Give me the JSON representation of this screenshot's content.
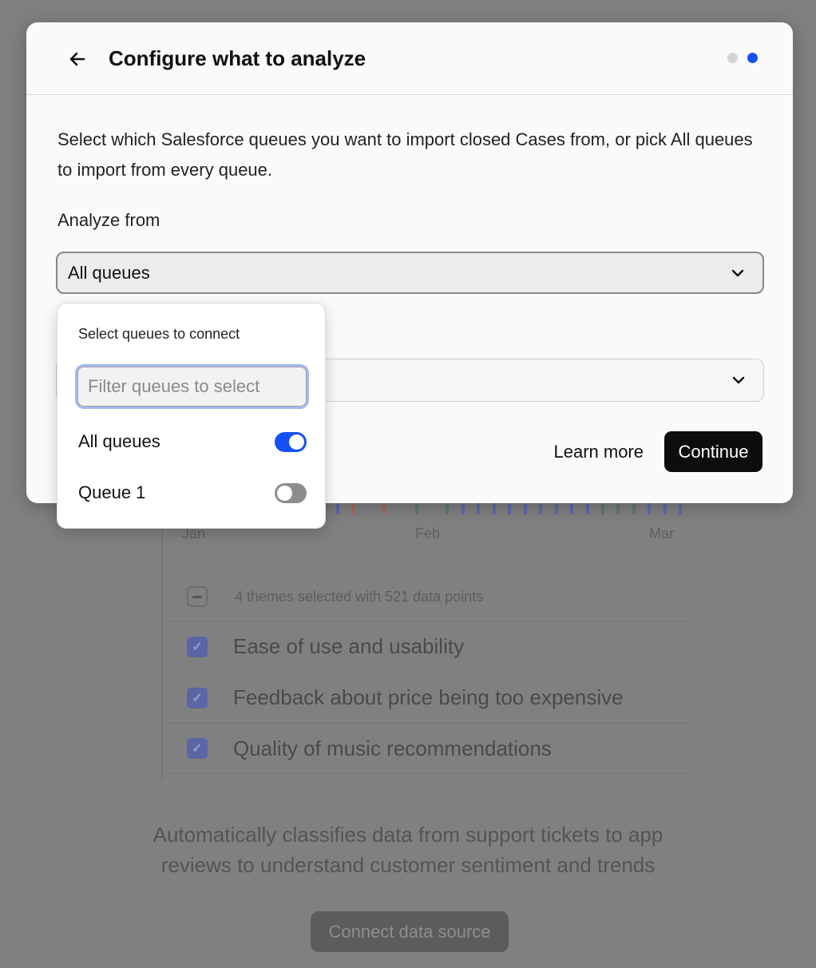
{
  "background": {
    "months": [
      "Jan",
      "Feb",
      "Mar"
    ],
    "summary": "4 themes selected with 521 data points",
    "themes": [
      {
        "label": "Ease of use and usability",
        "checked": true
      },
      {
        "label": "Feedback about price being too expensive",
        "checked": true
      },
      {
        "label": "Quality of music recommendations",
        "checked": true
      }
    ],
    "description_line1": "Automatically classifies data from support tickets to app",
    "description_line2": "reviews to understand customer sentiment and trends",
    "connect_button": "Connect data source",
    "bar_colors": [
      "#5a6bb0",
      "#a8685a",
      "#5f7a68"
    ]
  },
  "modal": {
    "title": "Configure what to analyze",
    "steps_total": 2,
    "current_step": 2,
    "description": "Select which Salesforce queues you want to import closed Cases from, or pick All queues to import from every queue.",
    "analyze_label": "Analyze from",
    "analyze_value": "All queues",
    "second_select_value": "",
    "learn_more": "Learn more",
    "continue": "Continue",
    "accent_color": "#1451f0"
  },
  "dropdown": {
    "heading": "Select queues to connect",
    "filter_placeholder": "Filter queues to select",
    "filter_value": "",
    "options": [
      {
        "label": "All queues",
        "enabled": true
      },
      {
        "label": "Queue 1",
        "enabled": false
      }
    ]
  }
}
